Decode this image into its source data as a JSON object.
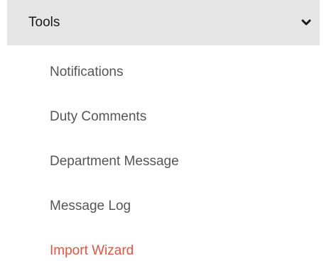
{
  "menu": {
    "header": {
      "label": "Tools",
      "toggle_icon": "chevron-down-icon",
      "expanded": true
    },
    "items": [
      {
        "label": "Notifications",
        "active": false
      },
      {
        "label": "Duty Comments",
        "active": false
      },
      {
        "label": "Department Message",
        "active": false
      },
      {
        "label": "Message Log",
        "active": false
      },
      {
        "label": "Import Wizard",
        "active": true
      }
    ]
  },
  "colors": {
    "header_background": "#e6e6e6",
    "item_text": "#555555",
    "active_item_text": "#e8523f"
  }
}
